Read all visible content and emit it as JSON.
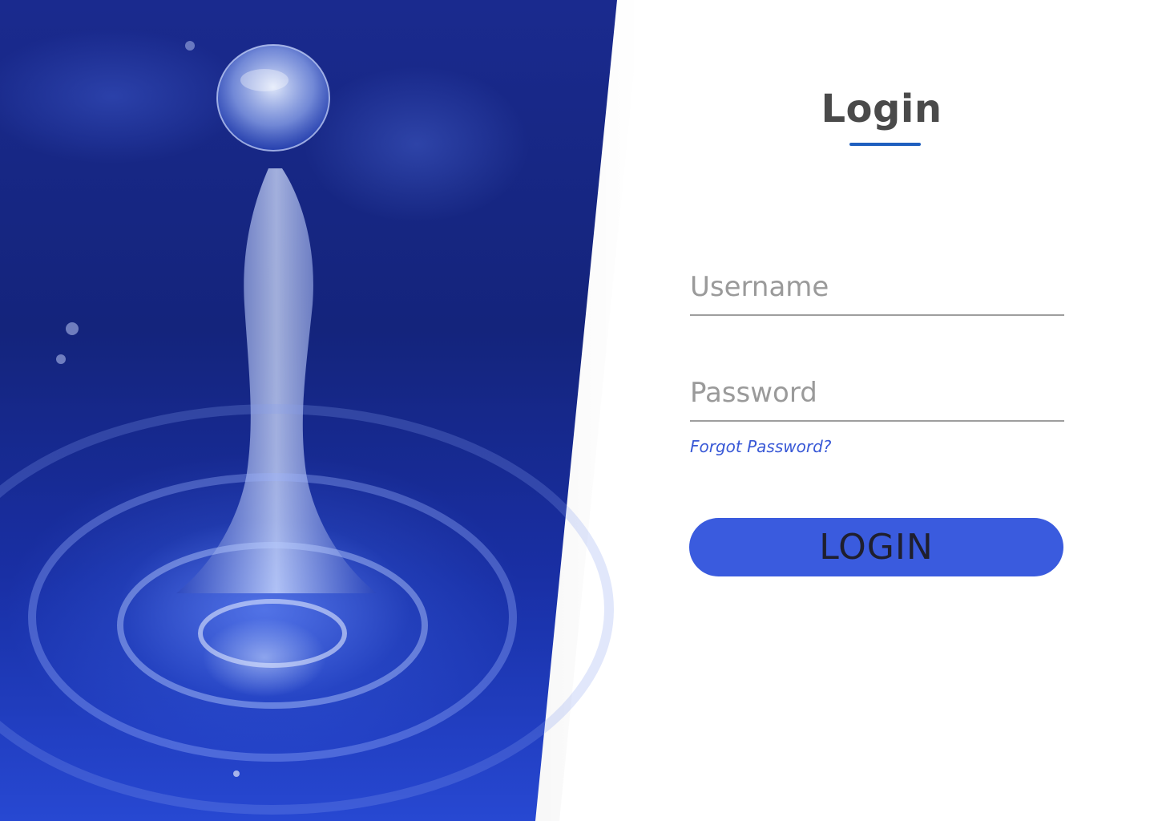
{
  "login": {
    "title": "Login",
    "username_placeholder": "Username",
    "password_placeholder": "Password",
    "forgot_password": "Forgot Password?",
    "submit": "LOGIN"
  },
  "colors": {
    "accent": "#3a5bde",
    "underline": "#1f5fbf",
    "link": "#3858d6",
    "title": "#4a4a4a"
  },
  "hero": {
    "icon": "water-drop-icon"
  }
}
